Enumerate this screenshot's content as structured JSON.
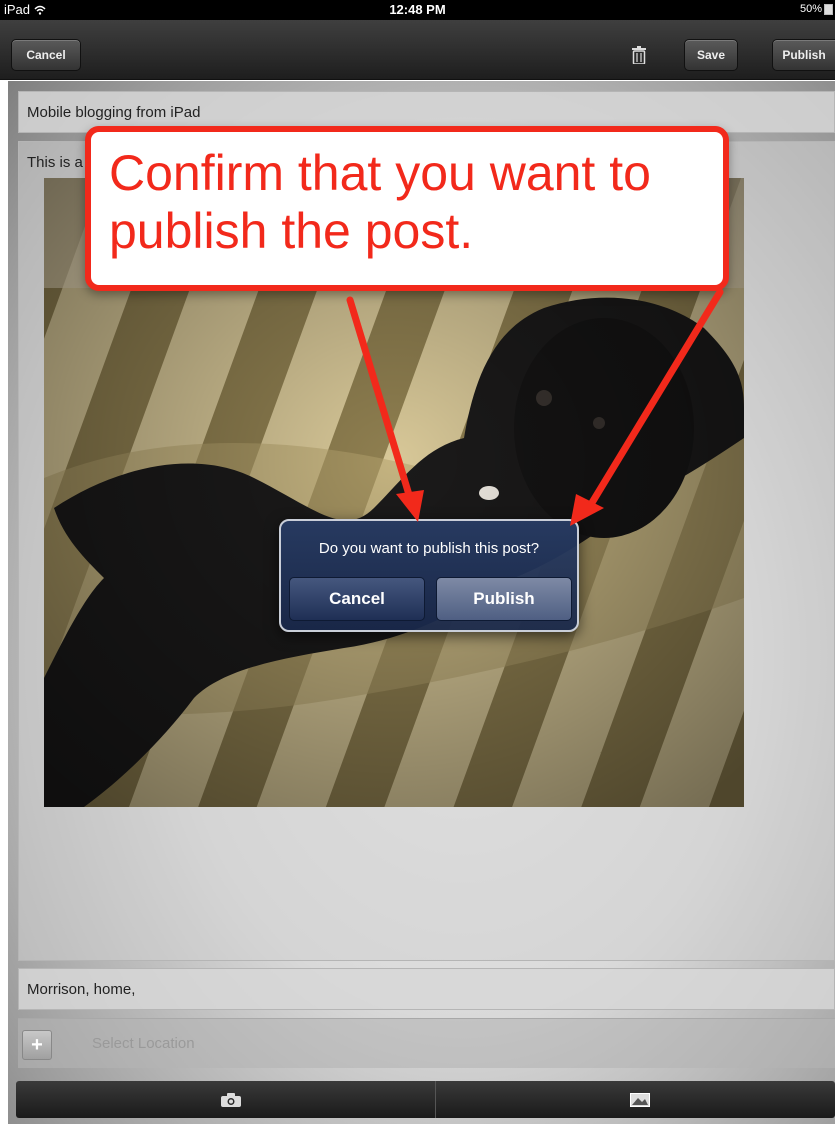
{
  "status_bar": {
    "device": "iPad",
    "time": "12:48 PM",
    "battery": "50%"
  },
  "toolbar": {
    "cancel_label": "Cancel",
    "save_label": "Save",
    "publish_label": "Publish"
  },
  "editor": {
    "title_value": "Mobile blogging from iPad",
    "body_value": "This is a",
    "tags_value": "Morrison, home,",
    "location_placeholder": "Select Location"
  },
  "alert": {
    "message": "Do you want to publish this post?",
    "cancel_label": "Cancel",
    "publish_label": "Publish"
  },
  "callout": {
    "text": "Confirm that you want to publish the post.",
    "color": "#f2291b"
  },
  "icons": [
    "wifi-icon",
    "battery-icon",
    "trash-icon",
    "plus-icon",
    "camera-icon",
    "image-icon"
  ]
}
